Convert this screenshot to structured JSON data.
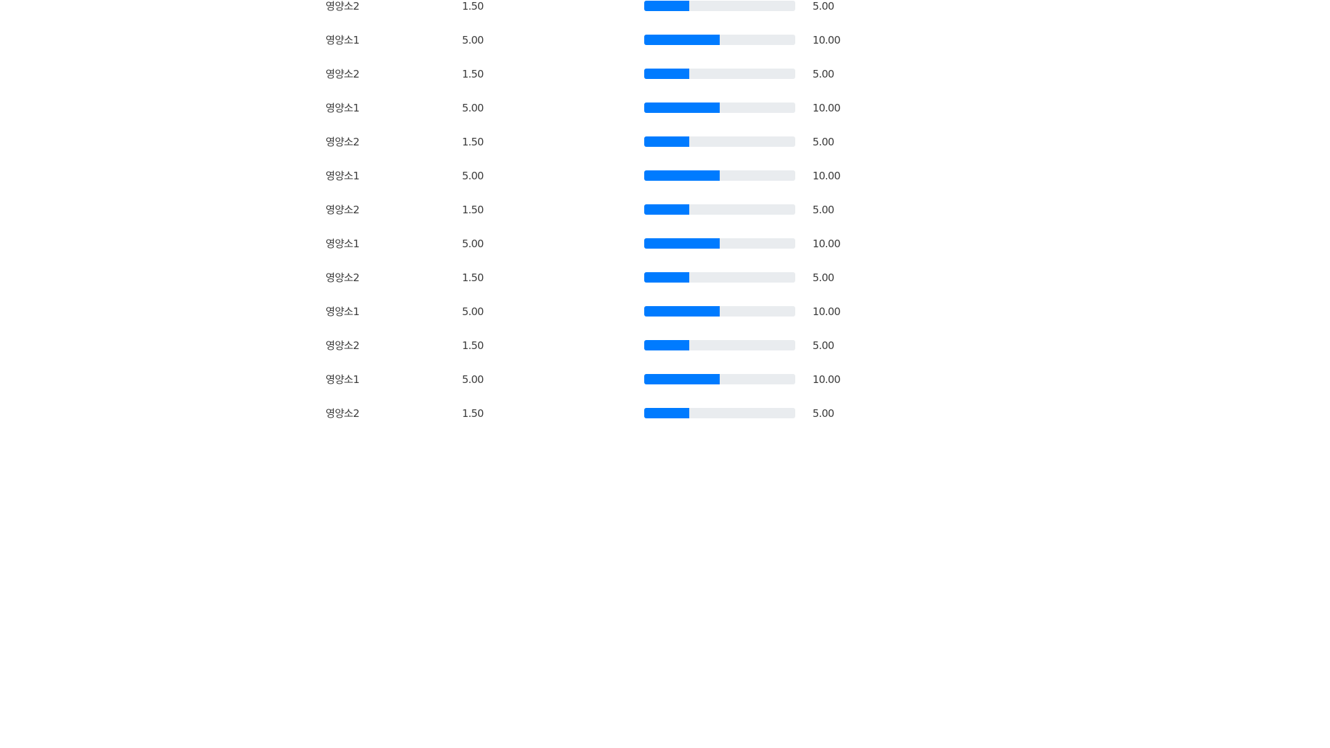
{
  "accent_color": "#007bff",
  "track_color": "#e9ecef",
  "rows": [
    {
      "name": "영양소2",
      "amount": "1.50",
      "target": "5.00",
      "fraction": 0.3
    },
    {
      "name": "영양소1",
      "amount": "5.00",
      "target": "10.00",
      "fraction": 0.5
    },
    {
      "name": "영양소2",
      "amount": "1.50",
      "target": "5.00",
      "fraction": 0.3
    },
    {
      "name": "영양소1",
      "amount": "5.00",
      "target": "10.00",
      "fraction": 0.5
    },
    {
      "name": "영양소2",
      "amount": "1.50",
      "target": "5.00",
      "fraction": 0.3
    },
    {
      "name": "영양소1",
      "amount": "5.00",
      "target": "10.00",
      "fraction": 0.5
    },
    {
      "name": "영양소2",
      "amount": "1.50",
      "target": "5.00",
      "fraction": 0.3
    },
    {
      "name": "영양소1",
      "amount": "5.00",
      "target": "10.00",
      "fraction": 0.5
    },
    {
      "name": "영양소2",
      "amount": "1.50",
      "target": "5.00",
      "fraction": 0.3
    },
    {
      "name": "영양소1",
      "amount": "5.00",
      "target": "10.00",
      "fraction": 0.5
    },
    {
      "name": "영양소2",
      "amount": "1.50",
      "target": "5.00",
      "fraction": 0.3
    },
    {
      "name": "영양소1",
      "amount": "5.00",
      "target": "10.00",
      "fraction": 0.5
    },
    {
      "name": "영양소2",
      "amount": "1.50",
      "target": "5.00",
      "fraction": 0.3
    }
  ]
}
